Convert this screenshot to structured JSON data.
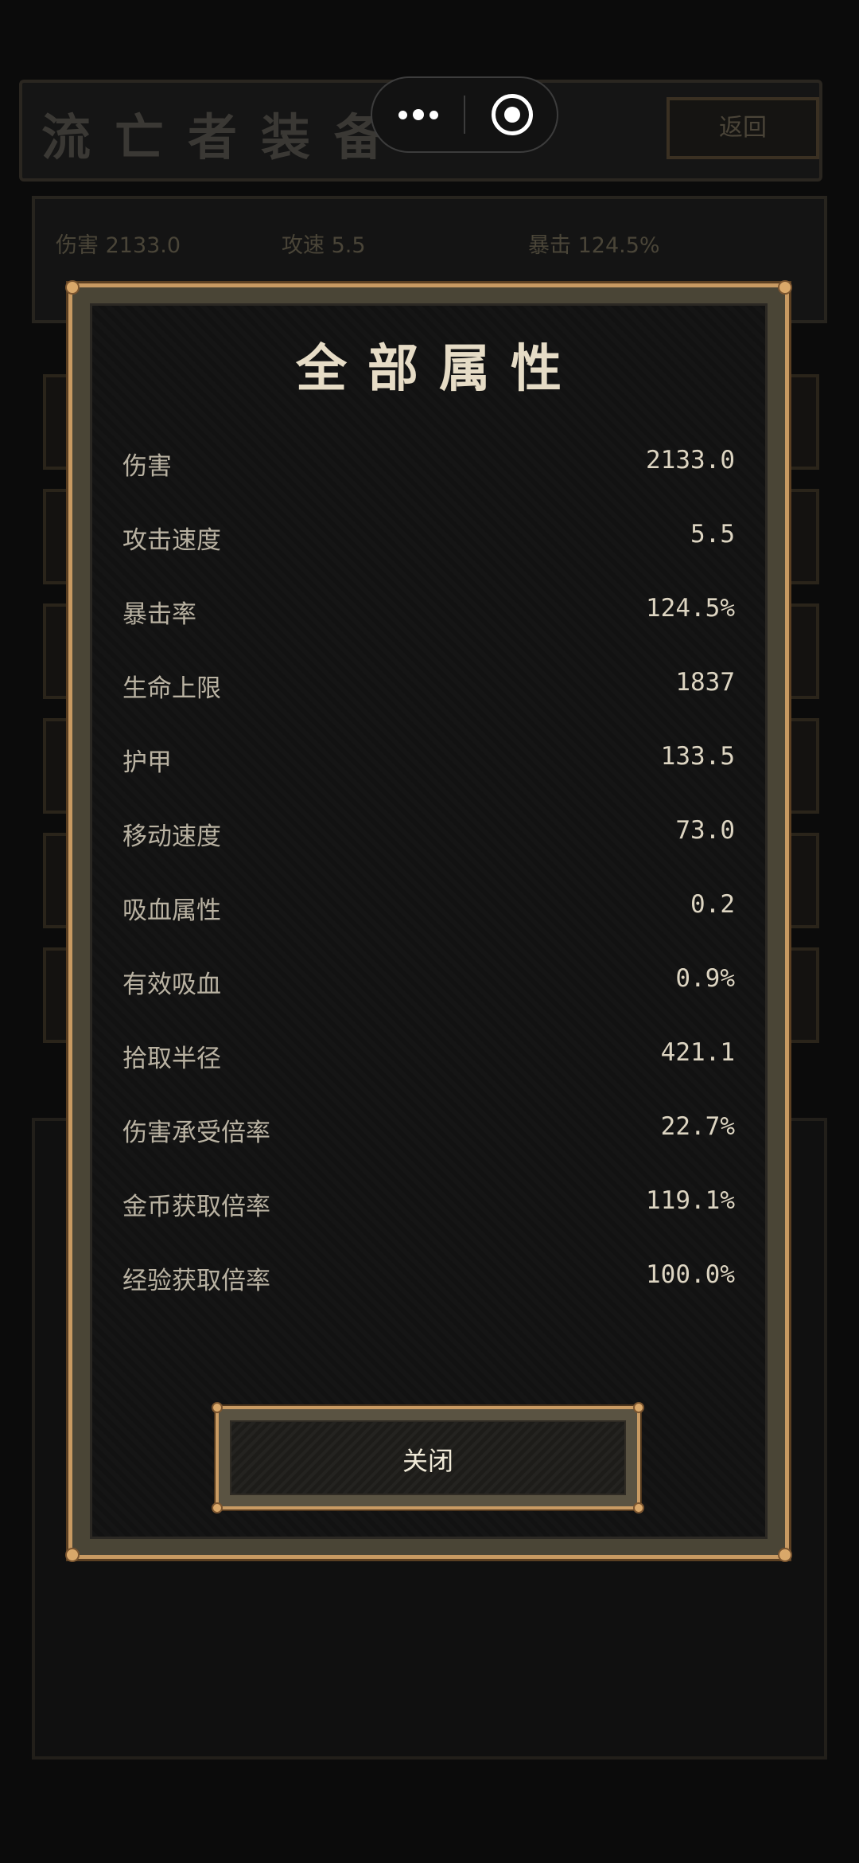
{
  "background": {
    "title": "流亡者装备",
    "back_label": "返回",
    "summary": {
      "damage_label": "伤害",
      "damage_value": "2133.0",
      "speed_label": "攻速",
      "speed_value": "5.5",
      "crit_label": "暴击",
      "crit_value": "124.5%"
    }
  },
  "modal": {
    "title": "全部属性",
    "stats": [
      {
        "label": "伤害",
        "value": "2133.0"
      },
      {
        "label": "攻击速度",
        "value": "5.5"
      },
      {
        "label": "暴击率",
        "value": "124.5%"
      },
      {
        "label": "生命上限",
        "value": "1837"
      },
      {
        "label": "护甲",
        "value": "133.5"
      },
      {
        "label": "移动速度",
        "value": "73.0"
      },
      {
        "label": "吸血属性",
        "value": "0.2"
      },
      {
        "label": "有效吸血",
        "value": "0.9%"
      },
      {
        "label": "拾取半径",
        "value": "421.1"
      },
      {
        "label": "伤害承受倍率",
        "value": "22.7%"
      },
      {
        "label": "金币获取倍率",
        "value": "119.1%"
      },
      {
        "label": "经验获取倍率",
        "value": "100.0%"
      }
    ],
    "close_label": "关闭"
  },
  "capsule": {
    "more_icon": "more-dots-icon",
    "close_icon": "target-close-icon"
  },
  "colors": {
    "frame_gold": "#c89a62",
    "panel_dark": "#121212",
    "text_light": "#e6dcc6"
  }
}
